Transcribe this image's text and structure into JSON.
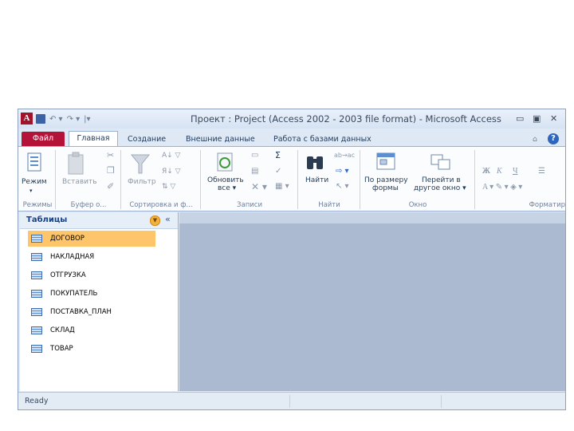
{
  "titlebar": {
    "app_icon": "A",
    "title": "Проект : Project  (Access 2002 - 2003 file format)  -  Microsoft Access",
    "qat_undo": "↶ ▾",
    "qat_redo": "↷ ▾",
    "qat_customize": "|▾",
    "minimize": "▭",
    "maximize": "▣",
    "close": "✕"
  },
  "tabs": {
    "file": "Файл",
    "home": "Главная",
    "create": "Создание",
    "external": "Внешние данные",
    "db_tools": "Работа с базами данных",
    "collapse": "⌂",
    "help": "?"
  },
  "ribbon": {
    "groups": {
      "views": "Режимы",
      "clipboard": "Буфер о...",
      "sort_filter": "Сортировка и ф...",
      "records": "Записи",
      "find": "Найти",
      "window": "Окно",
      "formatting": "Форматир"
    },
    "buttons": {
      "view": "Режим",
      "paste": "Вставить",
      "filter": "Фильтр",
      "refresh_1": "Обновить",
      "refresh_2": "все",
      "find": "Найти",
      "fit_form_1": "По размеру",
      "fit_form_2": "формы",
      "switch_window_1": "Перейти в",
      "switch_window_2": "другое окно",
      "bold": "Ж",
      "italic": "К",
      "underline": "Ч",
      "sum": "Σ"
    }
  },
  "nav": {
    "title": "Таблицы",
    "items": [
      "ДОГОВОР",
      "НАКЛАДНАЯ",
      "ОТГРУЗКА",
      "ПОКУПАТЕЛЬ",
      "ПОСТАВКА_ПЛАН",
      "СКЛАД",
      "ТОВАР"
    ],
    "selected_index": 0
  },
  "status": {
    "text": "Ready"
  },
  "colors": {
    "file_tab": "#b5123a",
    "selection": "#ffc56a",
    "workspace": "#abbad1"
  }
}
